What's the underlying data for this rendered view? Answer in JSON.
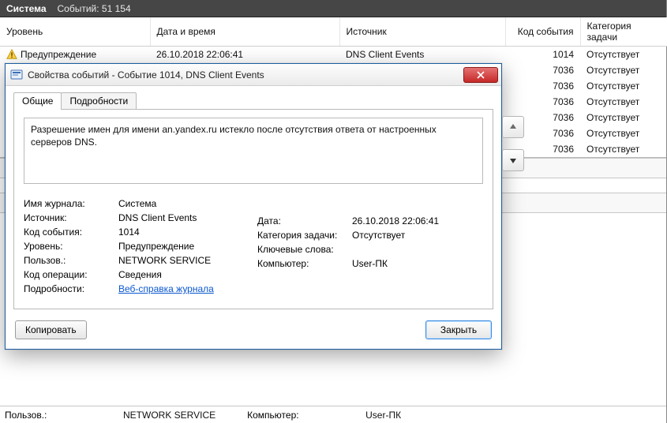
{
  "header": {
    "title": "Система",
    "events_label": "Событий: 51 154"
  },
  "columns": {
    "level": "Уровень",
    "datetime": "Дата и время",
    "source": "Источник",
    "code": "Код события",
    "task": "Категория задачи"
  },
  "rows": [
    {
      "icon": "warn",
      "level": "Предупреждение",
      "datetime": "26.10.2018 22:06:41",
      "source": "DNS Client Events",
      "code": "1014",
      "task": "Отсутствует"
    },
    {
      "icon": "info",
      "level": "",
      "datetime": "",
      "source": "",
      "code": "7036",
      "task": "Отсутствует"
    },
    {
      "icon": "info",
      "level": "",
      "datetime": "",
      "source": "",
      "code": "7036",
      "task": "Отсутствует"
    },
    {
      "icon": "info",
      "level": "",
      "datetime": "",
      "source": "",
      "code": "7036",
      "task": "Отсутствует"
    },
    {
      "icon": "info",
      "level": "",
      "datetime": "",
      "source": "",
      "code": "7036",
      "task": "Отсутствует"
    },
    {
      "icon": "info",
      "level": "",
      "datetime": "",
      "source": "",
      "code": "7036",
      "task": "Отсутствует"
    },
    {
      "icon": "info",
      "level": "",
      "datetime": "",
      "source": "",
      "code": "7036",
      "task": "Отсутствует"
    }
  ],
  "peek": {
    "user_label": "Пользов.:",
    "user_value": "NETWORK SERVICE",
    "computer_label": "Компьютер:",
    "computer_value": "User-ПК"
  },
  "dialog": {
    "title": "Свойства событий - Событие 1014, DNS Client Events",
    "tabs": {
      "general": "Общие",
      "details": "Подробности"
    },
    "description": "Разрешение имен для имени an.yandex.ru истекло после отсутствия ответа от настроенных серверов DNS.",
    "left": {
      "log_label": "Имя журнала:",
      "log_value": "Система",
      "source_label": "Источник:",
      "source_value": "DNS Client Events",
      "code_label": "Код события:",
      "code_value": "1014",
      "level_label": "Уровень:",
      "level_value": "Предупреждение",
      "user_label": "Пользов.:",
      "user_value": "NETWORK SERVICE",
      "op_label": "Код операции:",
      "op_value": "Сведения",
      "more_label": "Подробности:",
      "more_link": "Веб-справка журнала"
    },
    "right": {
      "date_label": "Дата:",
      "date_value": "26.10.2018 22:06:41",
      "task_label": "Категория задачи:",
      "task_value": "Отсутствует",
      "keywords_label": "Ключевые слова:",
      "keywords_value": "",
      "computer_label": "Компьютер:",
      "computer_value": "User-ПК"
    },
    "buttons": {
      "copy": "Копировать",
      "close": "Закрыть"
    }
  },
  "icons": {
    "warn": "warning-icon",
    "info": "info-icon"
  }
}
